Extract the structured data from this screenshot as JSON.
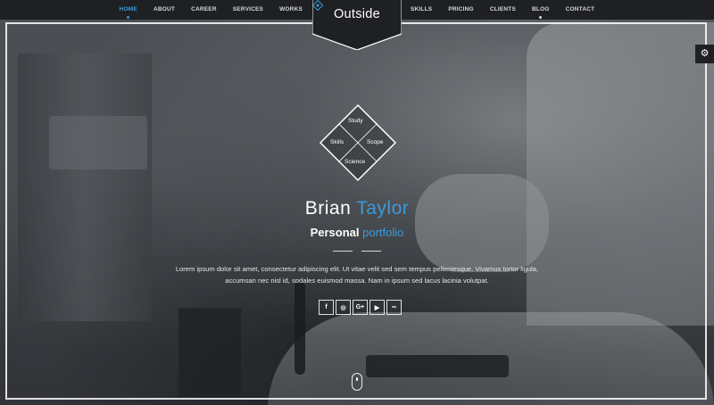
{
  "nav": {
    "left": [
      {
        "label": "HOME",
        "active": true
      },
      {
        "label": "ABOUT",
        "active": false
      },
      {
        "label": "CAREER",
        "active": false
      },
      {
        "label": "SERVICES",
        "active": false
      },
      {
        "label": "WORKS",
        "active": false
      }
    ],
    "right": [
      {
        "label": "SKILLS"
      },
      {
        "label": "PRICING"
      },
      {
        "label": "CLIENTS"
      },
      {
        "label": "BLOG",
        "dot": true
      },
      {
        "label": "CONTACT"
      }
    ]
  },
  "logo": {
    "text": "Outside",
    "icon": "diamond-icon"
  },
  "settings": {
    "icon": "gear-icon",
    "glyph": "⚙"
  },
  "emblem": {
    "top": "Study",
    "left": "Skills",
    "right": "Scope",
    "bottom": "Science"
  },
  "hero": {
    "first_name": "Brian",
    "last_name": "Taylor",
    "subtitle_main": "Personal",
    "subtitle_accent": "portfolio",
    "description_line1": "Lorem ipsum dolor sit amet, consectetur adipiscing elit. Ut vitae velit sed sem tempus pellentesque. Vivamus tortor ligula,",
    "description_line2": "accumsan nec nisl id, sodales euismod massa. Nam in ipsum sed lacus lacinia volutpat."
  },
  "social": [
    {
      "icon": "facebook-icon",
      "glyph": "f"
    },
    {
      "icon": "github-icon",
      "glyph": "◎"
    },
    {
      "icon": "google-plus-icon",
      "glyph": "G+"
    },
    {
      "icon": "youtube-icon",
      "glyph": "▶"
    },
    {
      "icon": "lastfm-icon",
      "glyph": "∞"
    }
  ],
  "colors": {
    "accent": "#3d9ad6",
    "nav_bg": "#1e2023"
  }
}
